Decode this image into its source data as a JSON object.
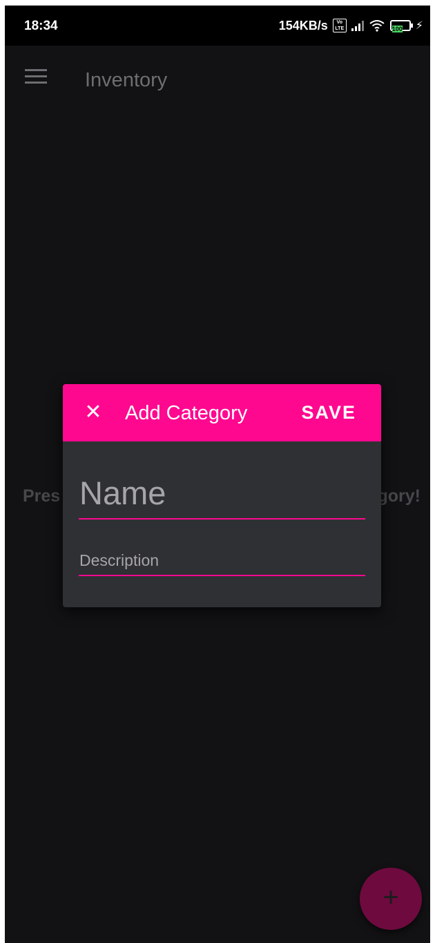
{
  "status_bar": {
    "time": "18:34",
    "net_speed": "154KB/s",
    "volte": "Vo LTE",
    "battery": "100",
    "icons": [
      "volte-icon",
      "signal-icon",
      "wifi-icon",
      "battery-icon",
      "charging-icon"
    ]
  },
  "app_bar": {
    "title": "Inventory",
    "menu_icon": "menu-icon"
  },
  "empty_hint": {
    "left_fragment": "Pres",
    "right_fragment": "gory!"
  },
  "dialog": {
    "title": "Add Category",
    "save_label": "SAVE",
    "close_icon": "close-icon",
    "name_placeholder": "Name",
    "description_placeholder": "Description"
  },
  "fab": {
    "icon": "plus-icon",
    "glyph": "+"
  },
  "colors": {
    "accent": "#ff0890",
    "background": "#121214",
    "dialog_bg": "#2f3033",
    "fab_bg": "#6e0a3e"
  }
}
